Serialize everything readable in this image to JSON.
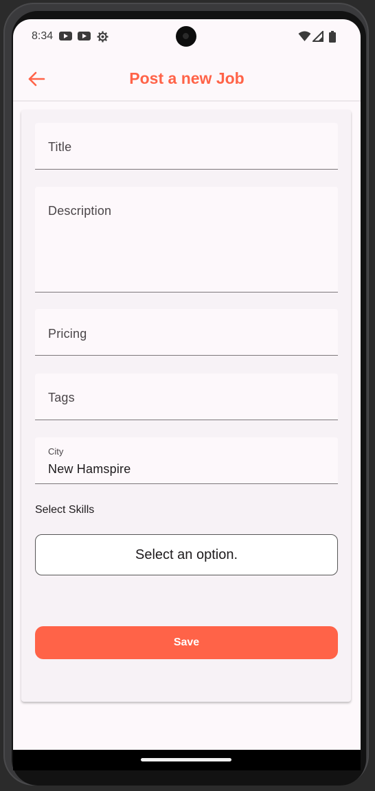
{
  "status_bar": {
    "time": "8:34",
    "left_icons": [
      "youtube-icon",
      "youtube-icon",
      "settings-gear-icon"
    ],
    "right_icons": [
      "wifi-icon",
      "cellular-signal-icon",
      "battery-icon"
    ]
  },
  "app_bar": {
    "title": "Post a new Job",
    "back_icon": "arrow-back-icon"
  },
  "form": {
    "title_label": "Title",
    "description_label": "Description",
    "pricing_label": "Pricing",
    "tags_label": "Tags",
    "city_label": "City",
    "city_value": "New Hamspire",
    "skills_label": "Select Skills",
    "skills_placeholder": "Select an option.",
    "save_label": "Save"
  },
  "colors": {
    "accent": "#ff6348",
    "background": "#fdf8fb",
    "card": "#f7f2f6"
  }
}
